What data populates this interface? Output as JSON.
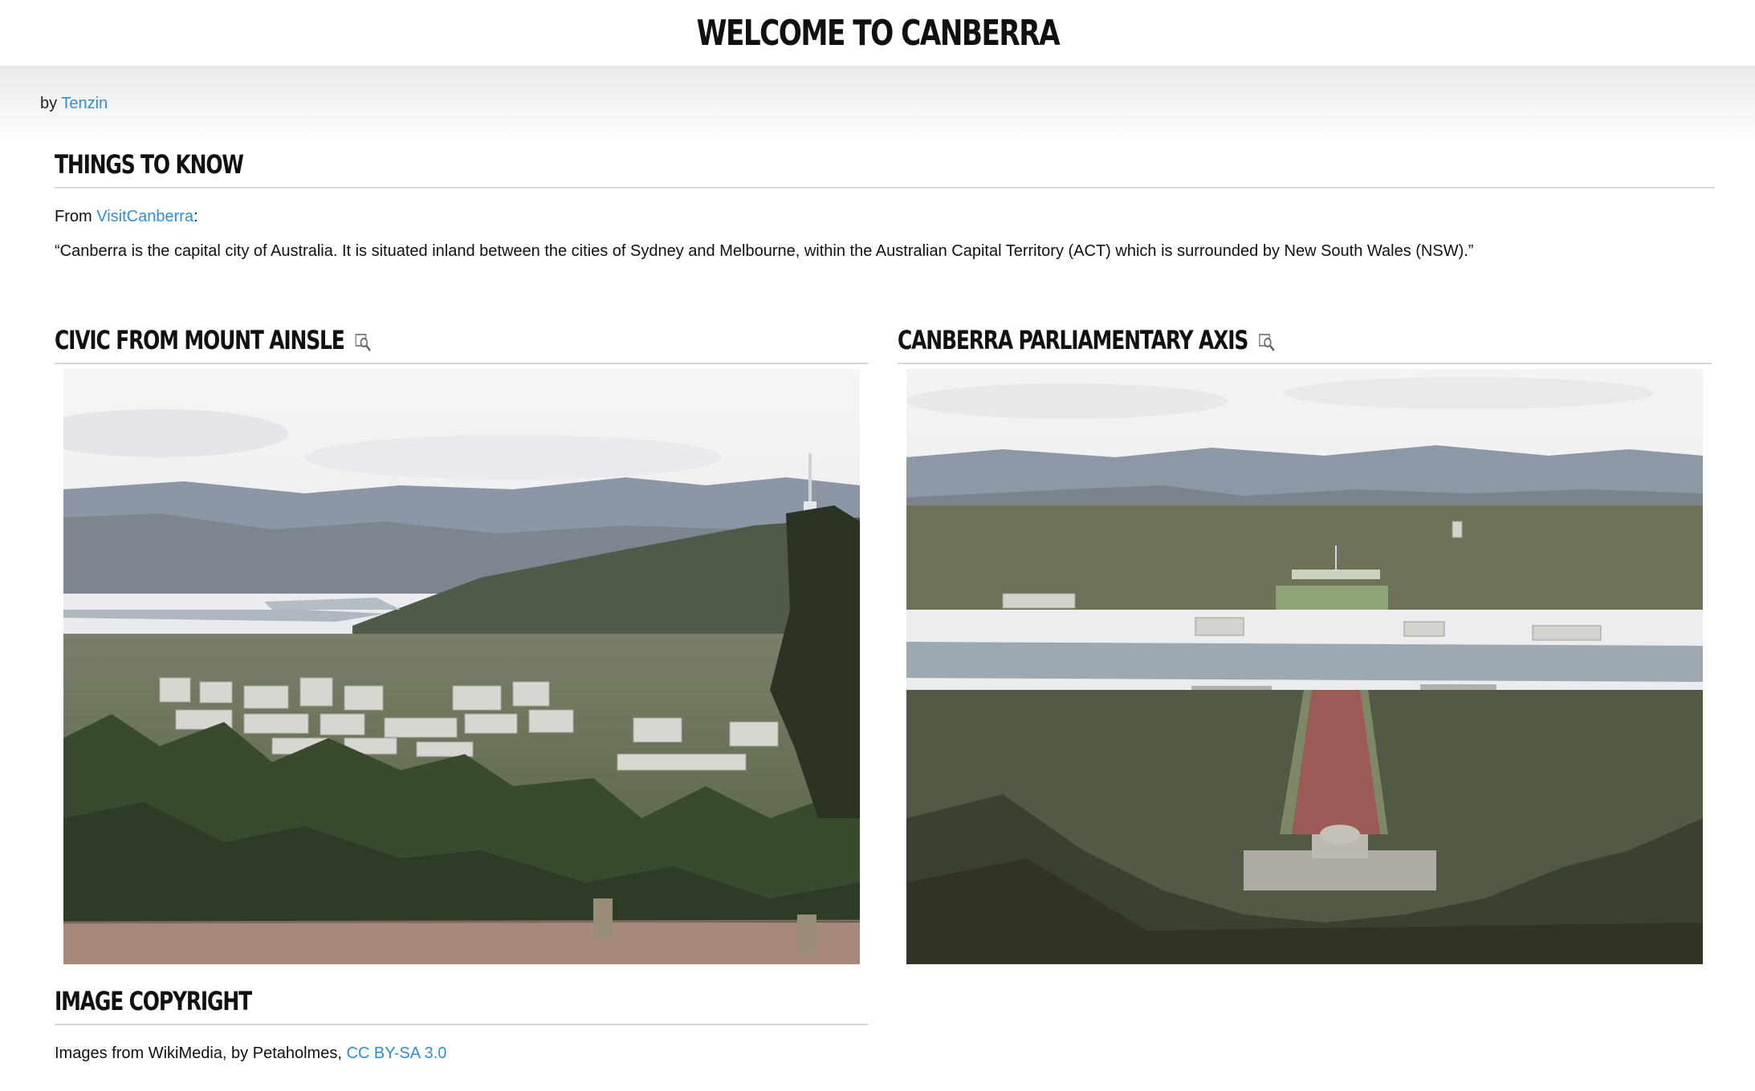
{
  "page": {
    "title": "WELCOME TO CANBERRA",
    "byline_prefix": "by",
    "author": "Tenzin"
  },
  "things_to_know": {
    "heading": "THINGS TO KNOW",
    "source_prefix": "From",
    "source_link": "VisitCanberra",
    "source_suffix": ":",
    "quote": "“Canberra is the capital city of Australia. It is situated inland between the cities of Sydney and Melbourne, within the Australian Capital Territory (ACT) which is surrounded by New South Wales (NSW).”"
  },
  "gallery": [
    {
      "heading": "CIVIC FROM MOUNT AINSLE",
      "icon": "magnify-image-icon"
    },
    {
      "heading": "CANBERRA PARLIAMENTARY AXIS",
      "icon": "magnify-image-icon"
    }
  ],
  "copyright": {
    "heading": "IMAGE COPYRIGHT",
    "text": "Images from WikiMedia, by Petaholmes,",
    "license_link": "CC BY-SA 3.0"
  },
  "colors": {
    "link": "#2f8fd3",
    "rule": "#d6d6d6",
    "heading": "#111111"
  }
}
